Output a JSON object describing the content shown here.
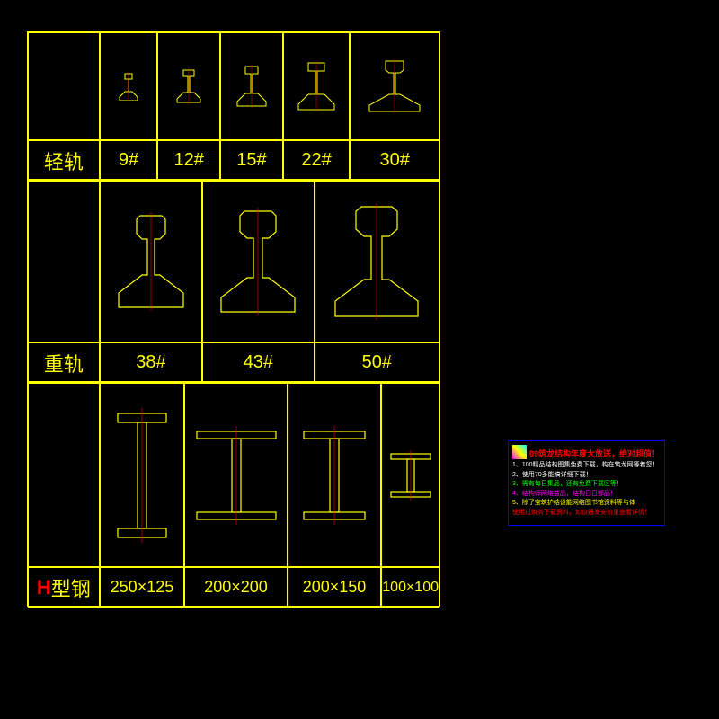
{
  "section1": {
    "label": "轻轨",
    "sizes": [
      "9#",
      "12#",
      "15#",
      "22#",
      "30#"
    ]
  },
  "section2": {
    "label": "重轨",
    "sizes": [
      "38#",
      "43#",
      "50#"
    ]
  },
  "section3": {
    "labelPrefix": "H",
    "labelSuffix": "型钢",
    "sizes": [
      "250×125",
      "200×200",
      "200×150",
      "100×100"
    ]
  },
  "legend": {
    "title": "09筑龙结构年度大放送，绝对超值！",
    "items": [
      "1、100精品结构图集免费下载，构在筑龙网等着您！",
      "2、使用70多能搞详细下载！",
      "3、需有每日集品，还有免费下载区等！",
      "4、结构师网络益品，结构日日都品！",
      "5、除了宝筑护结设能网络图书馆资料等与体",
      "使用过筑务下载资料，如仪器发安价重查看详情！"
    ]
  }
}
